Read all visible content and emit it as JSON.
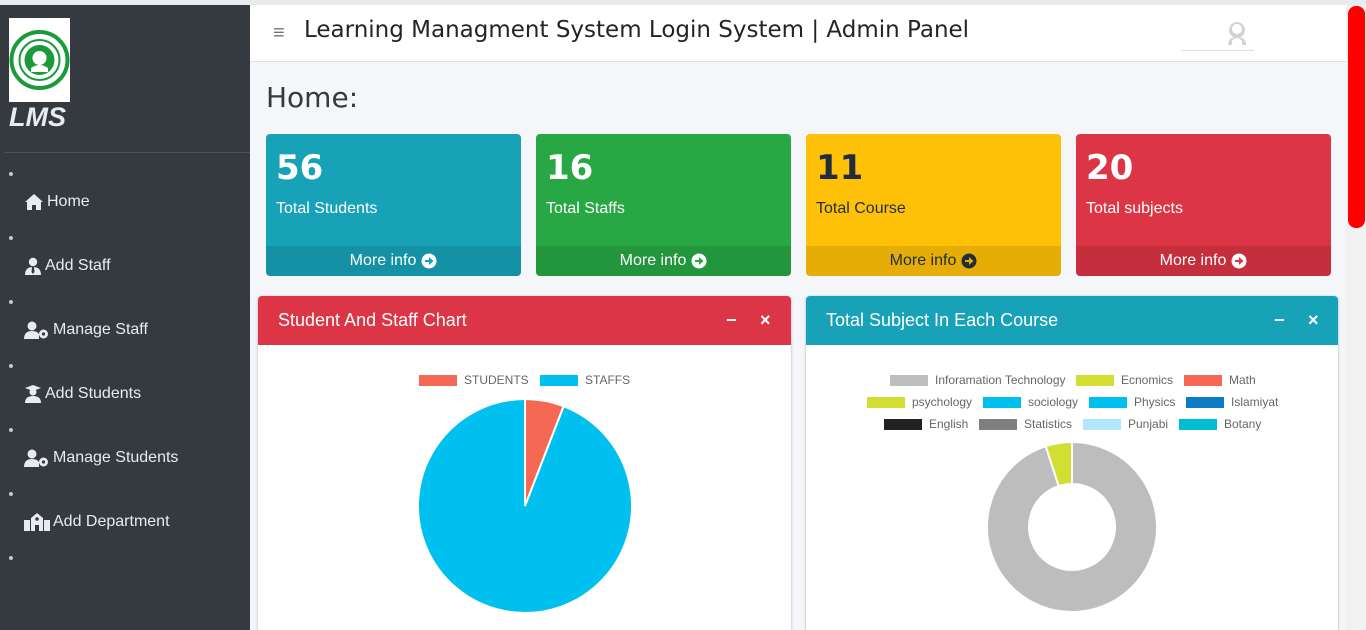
{
  "sidebar": {
    "brand": "LMS",
    "logo": {
      "ring_text": "GOVT. M.A.O. COLLEGE",
      "bottom_text": "LAHORE"
    },
    "items": [
      {
        "label": "Home",
        "icon": "home-icon"
      },
      {
        "label": "Add Staff",
        "icon": "user-tie-icon"
      },
      {
        "label": "Manage Staff",
        "icon": "users-cog-icon"
      },
      {
        "label": "Add Students",
        "icon": "user-graduate-icon"
      },
      {
        "label": "Manage Students",
        "icon": "users-cog-icon"
      },
      {
        "label": "Add Department",
        "icon": "school-icon"
      }
    ]
  },
  "header": {
    "title": "Learning Managment System Login System | Admin Panel",
    "menu_icon": "hamburger-icon",
    "user_icon": "user-avatar-icon"
  },
  "page": {
    "title": "Home:"
  },
  "stat_boxes": [
    {
      "value": "56",
      "label": "Total Students",
      "more": "More info",
      "color": "#17a2b8"
    },
    {
      "value": "16",
      "label": "Total Staffs",
      "more": "More info",
      "color": "#28a745"
    },
    {
      "value": "11",
      "label": "Total Course",
      "more": "More info",
      "color": "#ffc107"
    },
    {
      "value": "20",
      "label": "Total subjects",
      "more": "More info",
      "color": "#dc3545"
    }
  ],
  "cards": {
    "staff_chart": {
      "title": "Student And Staff Chart",
      "color": "#dc3545"
    },
    "subject_chart": {
      "title": "Total Subject In Each Course",
      "color": "#17a2b8"
    }
  },
  "chart_data": [
    {
      "type": "pie",
      "labels": [
        "STUDENTS",
        "STAFFS"
      ],
      "values": [
        1,
        16
      ],
      "colors": [
        "#f56954",
        "#00c0ef"
      ],
      "legend": "top"
    },
    {
      "type": "doughnut",
      "labels": [
        "Inforamation Technology",
        "Ecnomics",
        "Math",
        "psychology",
        "sociology",
        "Physics",
        "Islamiyat",
        "English",
        "Statistics",
        "Punjabi",
        "Botany"
      ],
      "values": [
        19,
        1,
        0,
        0,
        0,
        0,
        0,
        0,
        0,
        0,
        0
      ],
      "colors": [
        "#bdbdbd",
        "#d2de32",
        "#f56954",
        "#d2de32",
        "#00c0ef",
        "#00c0ef",
        "#0e7cc4",
        "#222222",
        "#7f7f7f",
        "#b3e5fc",
        "#00bcd4"
      ],
      "legend": "top"
    }
  ]
}
